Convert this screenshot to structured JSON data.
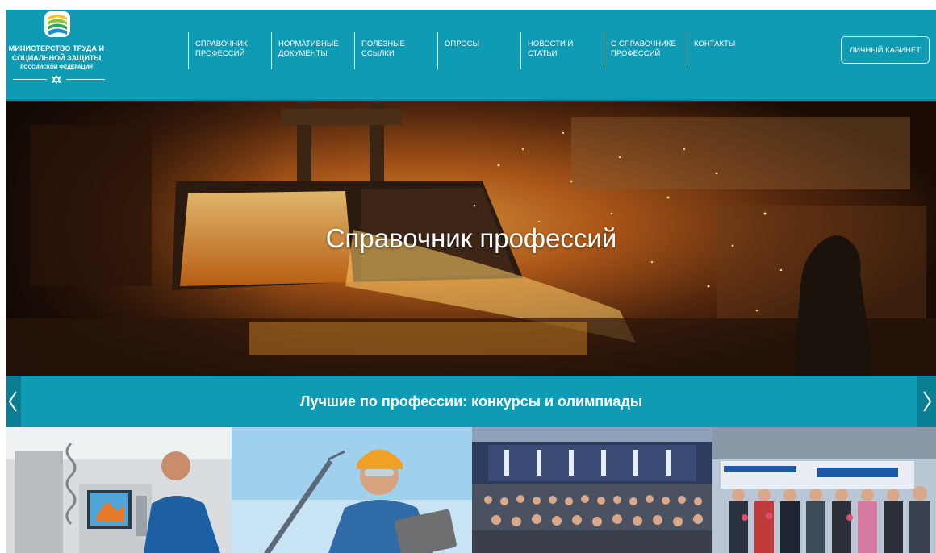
{
  "logo": {
    "line1": "МИНИСТЕРСТВО ТРУДА И",
    "line2": "СОЦИАЛЬНОЙ ЗАЩИТЫ",
    "line3": "РОССИЙСКОЙ ФЕДЕРАЦИИ",
    "emblem_icon": "ministry-emblem-icon",
    "seal_icon": "double-headed-eagle-icon"
  },
  "nav": {
    "items": [
      {
        "label": "СПРАВОЧНИК ПРОФЕССИЙ"
      },
      {
        "label": "НОРМАТИВНЫЕ ДОКУМЕНТЫ"
      },
      {
        "label": "ПОЛЕЗНЫЕ ССЫЛКИ"
      },
      {
        "label": "ОПРОСЫ"
      },
      {
        "label": "НОВОСТИ И СТАТЬИ"
      },
      {
        "label": "О СПРАВОЧНИКЕ ПРОФЕССИЙ"
      },
      {
        "label": "КОНТАКТЫ"
      }
    ],
    "cabinet_label": "ЛИЧНЫЙ КАБИНЕТ"
  },
  "hero": {
    "title": "Справочник профессий"
  },
  "banner": {
    "title": "Лучшие по профессии: конкурсы и олимпиады",
    "prev_icon": "chevron-left-icon",
    "next_icon": "chevron-right-icon"
  },
  "colors": {
    "brand": "#0e9bb3",
    "brand_dark": "#0a7f94",
    "text_on_brand": "#ffffff"
  }
}
